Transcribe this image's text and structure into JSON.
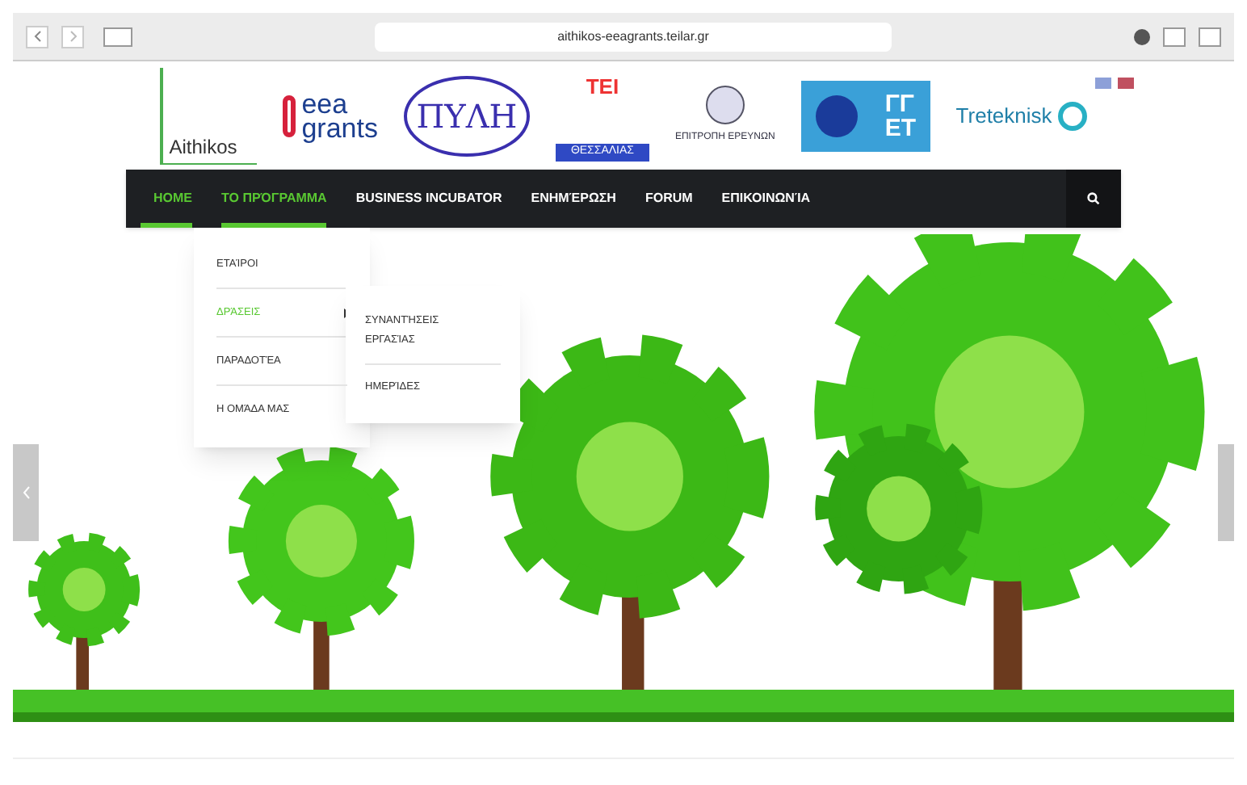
{
  "browser": {
    "url": "aithikos-eeagrants.teilar.gr"
  },
  "logos": [
    {
      "kind": "aithikos",
      "texts": [
        "Aithikos"
      ]
    },
    {
      "kind": "eea",
      "texts": [
        "eea",
        "grants"
      ]
    },
    {
      "kind": "pyli",
      "texts": [
        "ΠΥΛΗ"
      ]
    },
    {
      "kind": "tei",
      "texts": [
        "ΤΕΙ",
        "ΘΕΣΣΑΛΙΑΣ"
      ]
    },
    {
      "kind": "university",
      "texts": [
        "ΕΠΙΤΡΟΠΗ ΕΡΕΥΝΩΝ"
      ]
    },
    {
      "kind": "gget",
      "texts": [
        "ΓΓ",
        "ΕΤ"
      ]
    },
    {
      "kind": "treteknisk",
      "texts": [
        "Treteknisk"
      ]
    }
  ],
  "nav": {
    "items": [
      {
        "label": "HOME",
        "active": true
      },
      {
        "label": "ΤΟ ΠΡΌΓΡΑΜΜΑ",
        "active": true,
        "menu": [
          {
            "label": "ΕΤΑΊΡΟΙ",
            "selected": false
          },
          {
            "label": "ΔΡΆΣΕΙΣ",
            "selected": true,
            "submenu": [
              "ΣΥΝΑΝΤΉΣΕΙΣ ΕΡΓΑΣΊΑΣ",
              "ΗΜΕΡΊΔΕΣ"
            ]
          },
          {
            "label": "ΠΑΡΑΔΟΤΈΑ",
            "selected": false
          },
          {
            "label": "Η ΟΜΆΔΑ ΜΑΣ",
            "selected": false
          }
        ]
      },
      {
        "label": "BUSINESS INCUBATOR",
        "active": false
      },
      {
        "label": "ΕΝΗΜΈΡΩΣΗ",
        "active": false
      },
      {
        "label": "FORUM",
        "active": false
      },
      {
        "label": "ΕΠΙΚΟΙΝΩΝΊΑ",
        "active": false
      }
    ]
  }
}
